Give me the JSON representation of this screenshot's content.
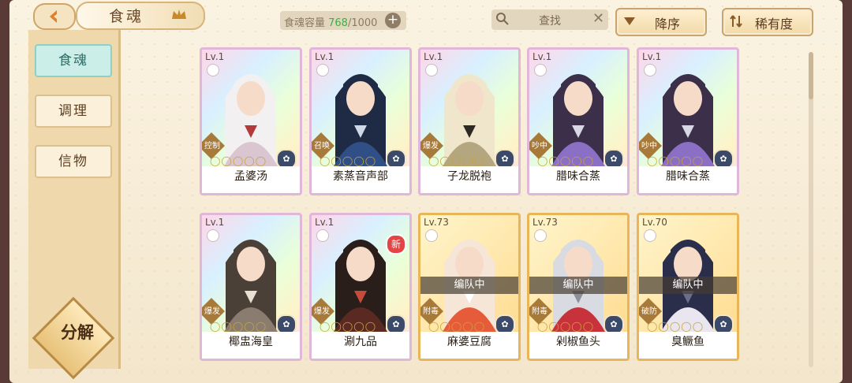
{
  "header": {
    "title": "食魂",
    "capacity_label": "食魂容量 ",
    "capacity_current": "768",
    "capacity_total": "/1000",
    "add_label": "+",
    "search_label": "查找",
    "search_clear": "✕",
    "sort_order": "降序",
    "sort_field": "稀有度"
  },
  "sidebar": {
    "items": [
      {
        "label": "食魂"
      },
      {
        "label": "调理"
      },
      {
        "label": "信物"
      }
    ],
    "decompose": "分解"
  },
  "cards": [
    {
      "level": "Lv.1",
      "name": "孟婆汤",
      "role": "控制",
      "frame": "rainbow",
      "status": "",
      "is_new": false,
      "stars": "◯◯◯◯◯"
    },
    {
      "level": "Lv.1",
      "name": "素蒸音声部",
      "role": "召唤",
      "frame": "rainbow",
      "status": "",
      "is_new": false,
      "stars": "◯◯◯◯◯"
    },
    {
      "level": "Lv.1",
      "name": "子龙脱袍",
      "role": "爆发",
      "frame": "rainbow",
      "status": "",
      "is_new": false,
      "stars": "◯◯◯◯◯"
    },
    {
      "level": "Lv.1",
      "name": "腊味合蒸",
      "role": "吵中",
      "frame": "rainbow",
      "status": "",
      "is_new": false,
      "stars": "◯◯◯◯◯"
    },
    {
      "level": "Lv.1",
      "name": "腊味合蒸",
      "role": "吵中",
      "frame": "rainbow",
      "status": "",
      "is_new": false,
      "stars": "◯◯◯◯◯"
    },
    {
      "level": "Lv.1",
      "name": "椰盅海皇",
      "role": "爆发",
      "frame": "rainbow",
      "status": "",
      "is_new": false,
      "stars": "◯◯◯◯◯"
    },
    {
      "level": "Lv.1",
      "name": "涮九品",
      "role": "爆发",
      "frame": "rainbow",
      "status": "",
      "is_new": true,
      "new_label": "新",
      "stars": "◯◯◯◯◯"
    },
    {
      "level": "Lv.73",
      "name": "麻婆豆腐",
      "role": "附毒",
      "frame": "gold",
      "status": "编队中",
      "is_new": false,
      "stars": "◯◯◯◯◯"
    },
    {
      "level": "Lv.73",
      "name": "剁椒鱼头",
      "role": "附毒",
      "frame": "gold",
      "status": "编队中",
      "is_new": false,
      "stars": "◯◯◯◯◯"
    },
    {
      "level": "Lv.70",
      "name": "臭鳜鱼",
      "role": "破防",
      "frame": "gold",
      "status": "编队中",
      "is_new": false,
      "stars": "◯◯◯◯◯"
    }
  ],
  "colors": {
    "accent": "#3cb043",
    "gold": "#e8b559",
    "teal": "#8ed0c6"
  }
}
